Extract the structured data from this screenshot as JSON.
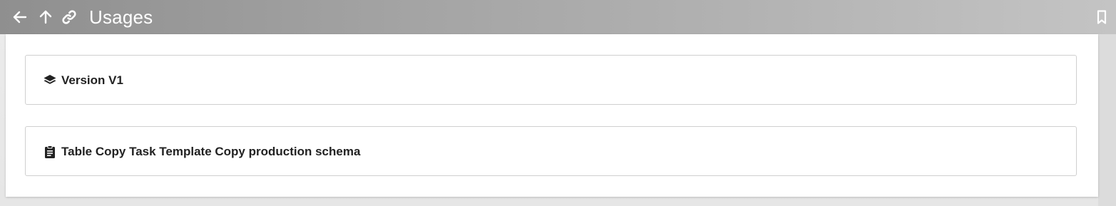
{
  "header": {
    "title": "Usages",
    "icons": {
      "back": "arrow-left-icon",
      "up": "arrow-up-icon",
      "link": "link-icon",
      "bookmark": "bookmark-icon"
    },
    "text_color": "#ffffff"
  },
  "usages": [
    {
      "label": "Version V1",
      "icon": "layers-icon"
    },
    {
      "label": "Table Copy Task Template Copy production schema",
      "icon": "clipboard-icon"
    }
  ],
  "colors": {
    "header_gradient_start": "#8f8f8f",
    "header_gradient_end": "#c4c4c4",
    "card_border": "#cfcfcf",
    "text": "#222222"
  }
}
